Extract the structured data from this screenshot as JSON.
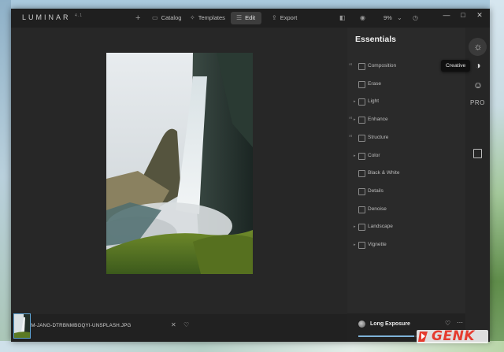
{
  "app": {
    "logo_text": "LUMINAR",
    "logo_version": "4.1"
  },
  "toolbar": {
    "add_icon": "plus-icon",
    "catalog_label": "Catalog",
    "templates_label": "Templates",
    "edit_label": "Edit",
    "export_label": "Export",
    "zoom_level": "9%"
  },
  "window_controls": {
    "minimize": "—",
    "maximize": "□",
    "close": "✕"
  },
  "filmstrip": {
    "filename": "ADAM-JANG-DTRBNMBGQYI-UNSPLASH.JPG"
  },
  "panel": {
    "title": "Essentials",
    "tools": [
      {
        "label": "Composition",
        "ai": "AI",
        "expandable": false
      },
      {
        "label": "Erase",
        "ai": "",
        "expandable": false
      },
      {
        "label": "Light",
        "ai": "",
        "expandable": true
      },
      {
        "label": "Enhance",
        "ai": "AI",
        "expandable": true
      },
      {
        "label": "Structure",
        "ai": "AI",
        "expandable": false
      },
      {
        "label": "Color",
        "ai": "",
        "expandable": true
      },
      {
        "label": "Black & White",
        "ai": "",
        "expandable": false
      },
      {
        "label": "Details",
        "ai": "",
        "expandable": false
      },
      {
        "label": "Denoise",
        "ai": "",
        "expandable": false
      },
      {
        "label": "Landscape",
        "ai": "",
        "expandable": true
      },
      {
        "label": "Vignette",
        "ai": "",
        "expandable": true
      }
    ],
    "preset": {
      "name": "Long Exposure",
      "progress": 0.6
    }
  },
  "sidebar": {
    "pro_label": "PRO"
  },
  "tooltip": {
    "text": "Creative"
  },
  "watermark": {
    "text": "GENK"
  },
  "colors": {
    "accent": "#7fb3d9",
    "watermark": "#e53b2f",
    "background": "#262626"
  }
}
